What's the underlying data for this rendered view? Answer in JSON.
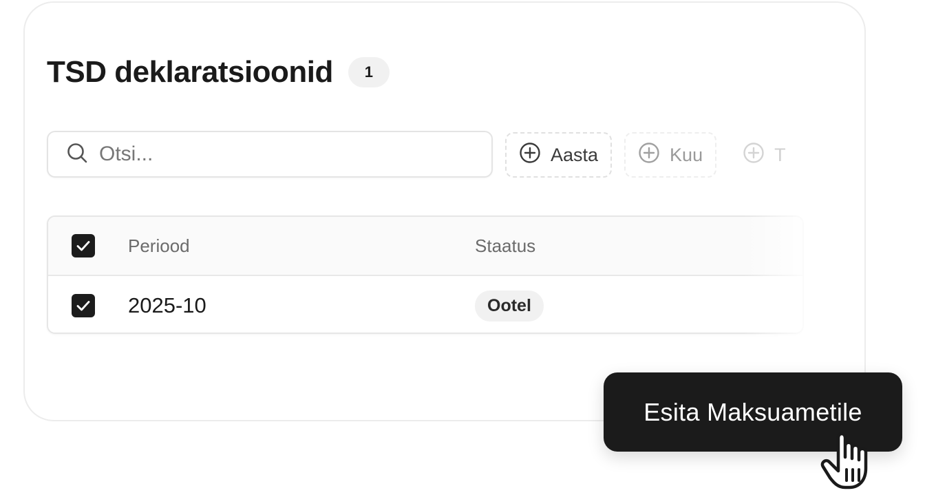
{
  "header": {
    "title": "TSD deklaratsioonid",
    "count": "1"
  },
  "search": {
    "placeholder": "Otsi..."
  },
  "filters": [
    {
      "label": "Aasta",
      "icon": "plus-circle-icon"
    },
    {
      "label": "Kuu",
      "icon": "plus-circle-icon"
    },
    {
      "label": "T",
      "icon": "plus-circle-icon"
    }
  ],
  "table": {
    "columns": [
      "Periood",
      "Staatus"
    ],
    "header_checked": true,
    "rows": [
      {
        "checked": true,
        "period": "2025-10",
        "status": "Ootel"
      }
    ]
  },
  "cta": {
    "label": "Esita Maksuametile"
  },
  "cursor": {
    "icon": "hand-pointer-icon"
  },
  "colors": {
    "accent": "#1b1b1b",
    "badge_bg": "#f1f1f1",
    "border": "#e6e6e6"
  }
}
